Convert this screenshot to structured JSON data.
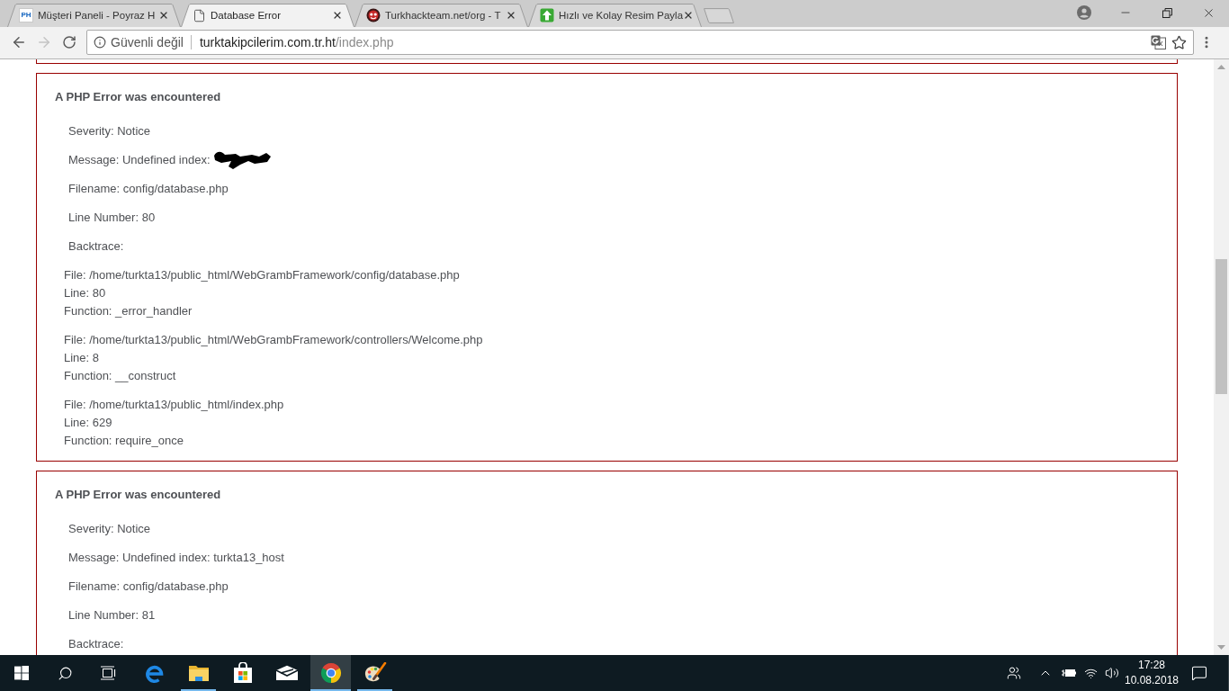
{
  "browser": {
    "tabs": [
      {
        "favicon_text": "PH",
        "title": "Müşteri Paneli - Poyraz H",
        "selected": false
      },
      {
        "title": "Database Error",
        "selected": true
      },
      {
        "title": "Turkhackteam.net/org - T",
        "selected": false
      },
      {
        "title": "Hızlı ve Kolay Resim Payla",
        "selected": false
      }
    ],
    "toolbar": {
      "forward_disabled": true
    },
    "address_bar": {
      "security_label": "Güvenli değil",
      "url_host": "turktakipcilerim.com.tr.ht",
      "url_path": "/index.php"
    }
  },
  "page": {
    "errors": [
      {
        "heading": "A PHP Error was encountered",
        "fields": [
          {
            "text": "Severity: Notice",
            "redacted": false
          },
          {
            "text": "Message: Undefined index:",
            "redacted": true
          },
          {
            "text": "Filename: config/database.php",
            "redacted": false
          },
          {
            "text": "Line Number: 80",
            "redacted": false
          },
          {
            "text": "Backtrace:",
            "redacted": false
          }
        ],
        "backtrace": [
          {
            "file": "File: /home/turkta13/public_html/WebGrambFramework/config/database.php",
            "line": "Line: 80",
            "function": "Function: _error_handler"
          },
          {
            "file": "File: /home/turkta13/public_html/WebGrambFramework/controllers/Welcome.php",
            "line": "Line: 8",
            "function": "Function: __construct"
          },
          {
            "file": "File: /home/turkta13/public_html/index.php",
            "line": "Line: 629",
            "function": "Function: require_once"
          }
        ]
      },
      {
        "heading": "A PHP Error was encountered",
        "fields": [
          {
            "text": "Severity: Notice",
            "redacted": false
          },
          {
            "text": "Message: Undefined index: turkta13_host",
            "redacted": false
          },
          {
            "text": "Filename: config/database.php",
            "redacted": false
          },
          {
            "text": "Line Number: 81",
            "redacted": false
          },
          {
            "text": "Backtrace:",
            "redacted": false
          }
        ]
      }
    ]
  },
  "taskbar": {
    "apps": [
      {
        "running": false,
        "active": false
      },
      {
        "running": true,
        "active": false
      },
      {
        "running": false,
        "active": false
      },
      {
        "running": false,
        "active": false
      },
      {
        "running": true,
        "active": true
      },
      {
        "running": true,
        "active": false
      }
    ],
    "clock": {
      "time": "17:28",
      "date": "10.08.2018"
    }
  }
}
